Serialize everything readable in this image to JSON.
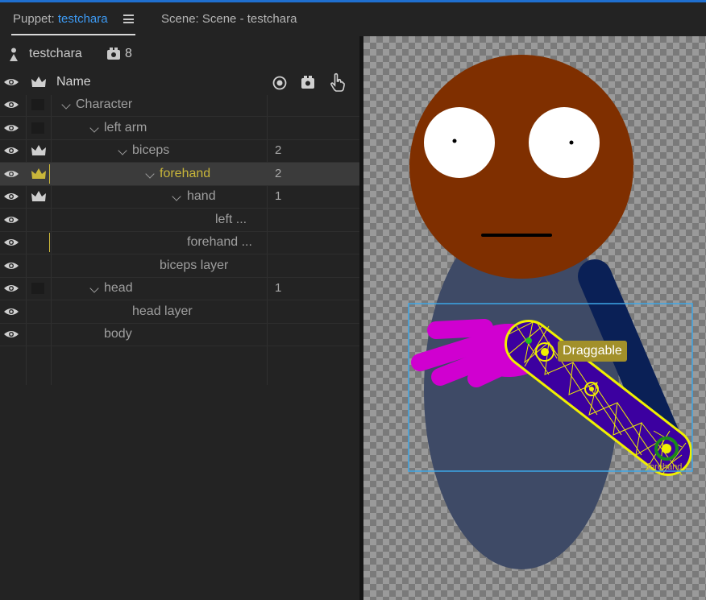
{
  "tabs": [
    {
      "prefix": "Puppet: ",
      "name": "testchara"
    },
    {
      "label": "Scene: Scene - testchara"
    }
  ],
  "puppet": {
    "name": "testchara",
    "count": "8"
  },
  "table": {
    "name_header": "Name",
    "rows": [
      {
        "label": "Character",
        "num": ""
      },
      {
        "label": "left arm",
        "num": ""
      },
      {
        "label": "biceps",
        "num": "2"
      },
      {
        "label": "forehand",
        "num": "2"
      },
      {
        "label": "hand",
        "num": "1"
      },
      {
        "label": "left ...",
        "num": ""
      },
      {
        "label": "forehand ...",
        "num": ""
      },
      {
        "label": "biceps layer",
        "num": ""
      },
      {
        "label": "head",
        "num": "1"
      },
      {
        "label": "head layer",
        "num": ""
      },
      {
        "label": "body",
        "num": ""
      }
    ]
  },
  "scene": {
    "tooltip": "Draggable",
    "handle_label": "forehand"
  },
  "colors": {
    "accent": "#3d9bf5",
    "selected_text": "#c9b63a",
    "mesh": "#f0f000"
  }
}
